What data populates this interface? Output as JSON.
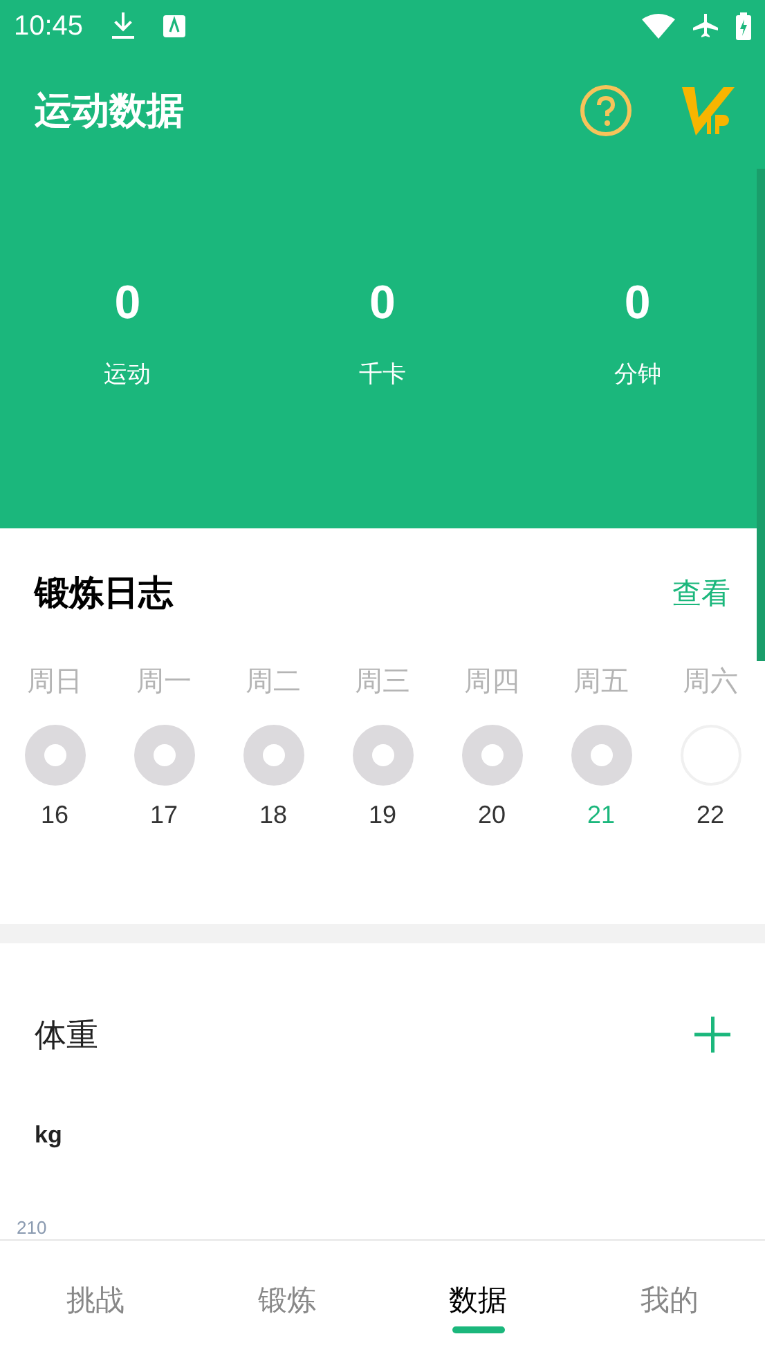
{
  "status_bar": {
    "time": "10:45"
  },
  "header": {
    "title": "运动数据"
  },
  "stats": [
    {
      "value": "0",
      "label": "运动"
    },
    {
      "value": "0",
      "label": "千卡"
    },
    {
      "value": "0",
      "label": "分钟"
    }
  ],
  "log": {
    "title": "锻炼日志",
    "link": "查看",
    "days": [
      {
        "weekday": "周日",
        "date": "16",
        "done": true,
        "selected": false
      },
      {
        "weekday": "周一",
        "date": "17",
        "done": true,
        "selected": false
      },
      {
        "weekday": "周二",
        "date": "18",
        "done": true,
        "selected": false
      },
      {
        "weekday": "周三",
        "date": "19",
        "done": true,
        "selected": false
      },
      {
        "weekday": "周四",
        "date": "20",
        "done": true,
        "selected": false
      },
      {
        "weekday": "周五",
        "date": "21",
        "done": true,
        "selected": true
      },
      {
        "weekday": "周六",
        "date": "22",
        "done": false,
        "selected": false
      }
    ]
  },
  "weight": {
    "title": "体重",
    "unit": "kg",
    "axis_label": "210"
  },
  "tabs": [
    {
      "label": "挑战",
      "selected": false
    },
    {
      "label": "锻炼",
      "selected": false
    },
    {
      "label": "数据",
      "selected": true
    },
    {
      "label": "我的",
      "selected": false
    }
  ]
}
